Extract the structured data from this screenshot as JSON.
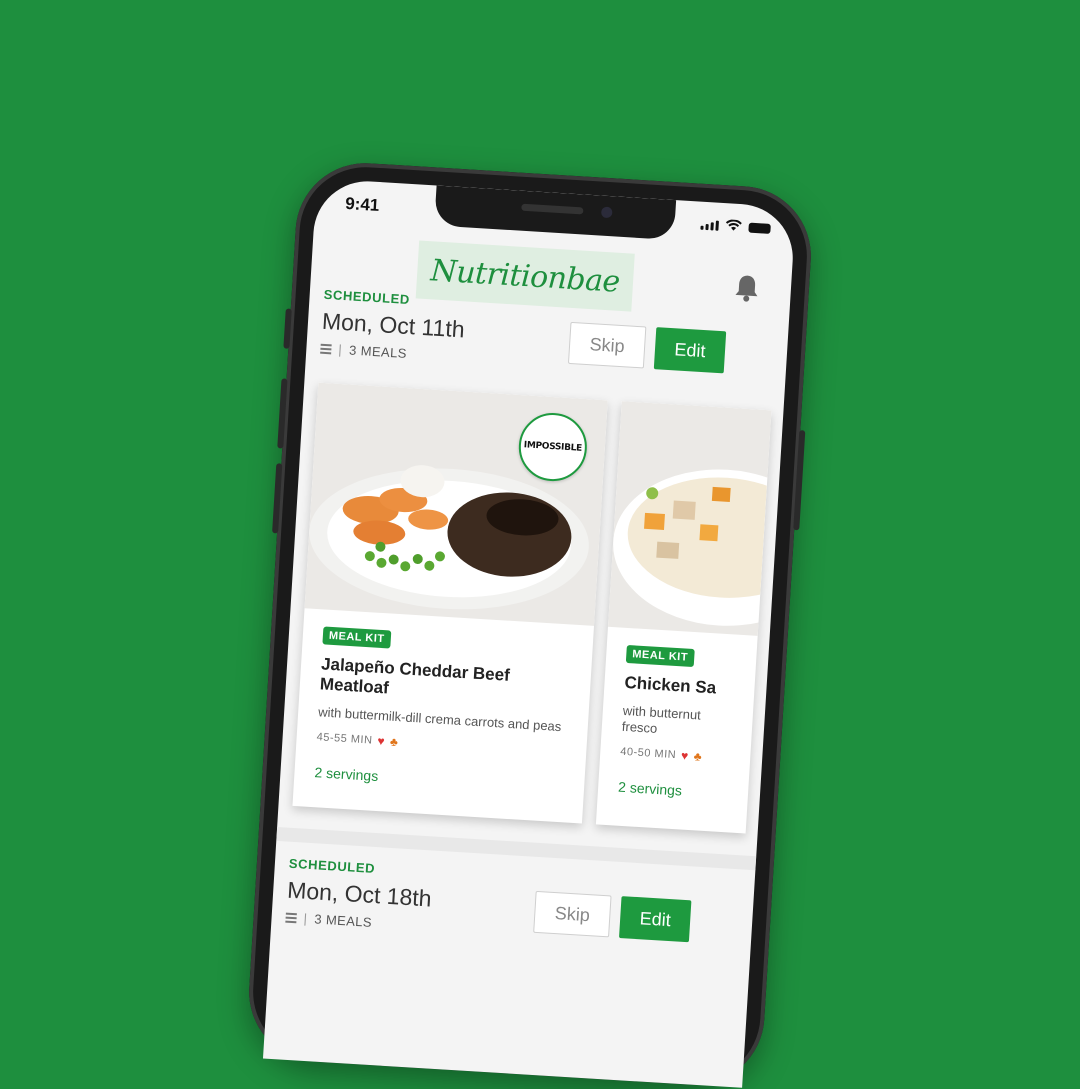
{
  "status_bar": {
    "time": "9:41"
  },
  "app": {
    "brand": "Nutritionbae",
    "accent_color": "#1e9a3f",
    "background_color": "#1e8f3e"
  },
  "header": {
    "bell_icon": "bell-icon"
  },
  "schedules": [
    {
      "tag": "SCHEDULED",
      "date": "Mon, Oct 11th",
      "meals": "3 MEALS",
      "skip_label": "Skip",
      "edit_label": "Edit"
    },
    {
      "tag": "SCHEDULED",
      "date": "Mon, Oct 18th",
      "meals": "3 MEALS",
      "skip_label": "Skip",
      "edit_label": "Edit"
    }
  ],
  "meals": [
    {
      "badge": "MEAL KIT",
      "title": "Jalapeño Cheddar Beef Meatloaf",
      "subtitle": "with buttermilk-dill crema carrots and peas",
      "time": "45-55 MIN",
      "servings": "2 servings",
      "promo_badge": "IMPOSSIBLE"
    },
    {
      "badge": "MEAL KIT",
      "title": "Chicken Sa",
      "subtitle": "with butternut fresco",
      "time": "40-50 MIN",
      "servings": "2 servings"
    }
  ]
}
